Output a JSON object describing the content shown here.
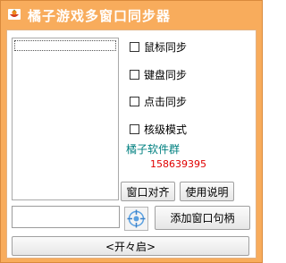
{
  "window": {
    "title": "橘子游戏多窗口同步器",
    "icon": "orange-bowl-icon",
    "title_bar_color": "#f8ac5c"
  },
  "sync_options": [
    {
      "label": "鼠标同步",
      "checked": false
    },
    {
      "label": "键盘同步",
      "checked": false
    },
    {
      "label": "点击同步",
      "checked": false
    },
    {
      "label": "核级模式",
      "checked": false
    }
  ],
  "group": {
    "name": "橘子软件群",
    "number": "158639395",
    "name_color": "#008080",
    "number_color": "#e00000"
  },
  "buttons": {
    "align_windows": "窗口对齐",
    "help": "使用说明",
    "add_window_handle": "添加窗口句柄",
    "start": "<开々启>"
  },
  "handle_input": {
    "value": ""
  },
  "icons": {
    "target": "crosshair-target-icon"
  }
}
